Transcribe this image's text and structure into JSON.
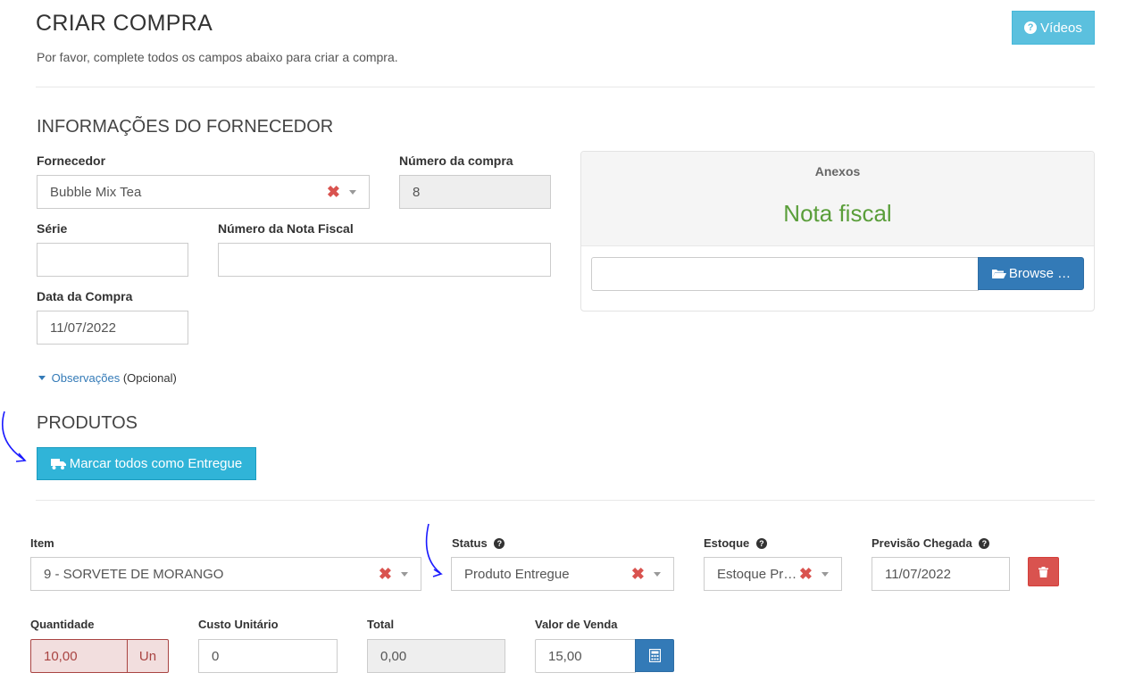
{
  "header": {
    "title": "CRIAR COMPRA",
    "subtitle": "Por favor, complete todos os campos abaixo para criar a compra.",
    "videos_button": "Vídeos"
  },
  "supplier_section": {
    "title": "INFORMAÇÕES DO FORNECEDOR",
    "fornecedor_label": "Fornecedor",
    "fornecedor_value": "Bubble Mix Tea",
    "numero_compra_label": "Número da compra",
    "numero_compra_value": "8",
    "serie_label": "Série",
    "serie_value": "",
    "nota_fiscal_label": "Número da Nota Fiscal",
    "nota_fiscal_value": "",
    "data_compra_label": "Data da Compra",
    "data_compra_value": "11/07/2022",
    "observacoes_link": "Observações",
    "observacoes_optional": "(Opcional)"
  },
  "attachments": {
    "title": "Anexos",
    "subtitle": "Nota fiscal",
    "file_value": "",
    "browse_button": "Browse …"
  },
  "products_section": {
    "title": "PRODUTOS",
    "mark_all_button": "Marcar todos como Entregue"
  },
  "product_row": {
    "item_label": "Item",
    "item_value": "9 - SORVETE DE MORANGO",
    "status_label": "Status",
    "status_value": "Produto Entregue",
    "estoque_label": "Estoque",
    "estoque_value": "Estoque Principal",
    "previsao_label": "Previsão Chegada",
    "previsao_value": "11/07/2022",
    "quantidade_label": "Quantidade",
    "quantidade_value": "10,00",
    "unit": "Un",
    "custo_label": "Custo Unitário",
    "custo_value": "0",
    "total_label": "Total",
    "total_value": "0,00",
    "valor_venda_label": "Valor de Venda",
    "valor_venda_value": "15,00"
  },
  "icons": {
    "videos": "question-circle-icon",
    "browse": "folder-open-icon",
    "mark_all": "truck-icon",
    "delete": "trash-icon",
    "calculator": "calculator-icon",
    "help": "question-circle-icon"
  },
  "colors": {
    "info": "#5bc0de",
    "primary": "#337ab7",
    "danger": "#d9534f",
    "success_text": "#5a9e3a",
    "link": "#337ab7",
    "annotation_arrow": "#1a1aff"
  }
}
